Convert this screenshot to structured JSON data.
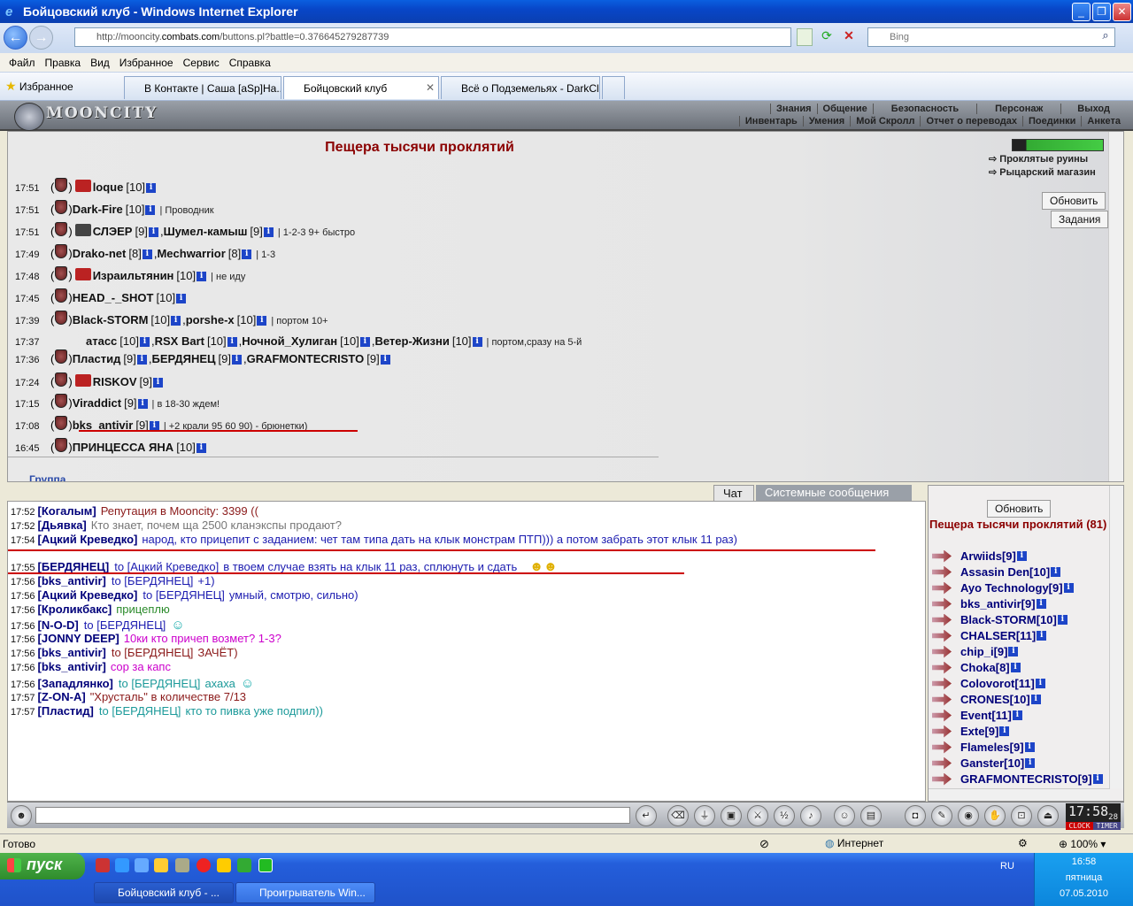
{
  "browser": {
    "title": "Бойцовский клуб - Windows Internet Explorer",
    "url_prefix": "http://mooncity.",
    "url_host": "combats.com",
    "url_rest": "/buttons.pl?battle=0.376645279287739",
    "search_placeholder": "Bing",
    "menu": [
      "Файл",
      "Правка",
      "Вид",
      "Избранное",
      "Сервис",
      "Справка"
    ],
    "favorites": "Избранное",
    "tabs": [
      "В Контакте | Саша [aSp]На...",
      "Бойцовский клуб",
      "Всё о Подземельях - DarkCl..."
    ]
  },
  "game": {
    "logo": "MOONCITY",
    "menu_top": [
      "Знания",
      "Общение",
      "Безопасность",
      "Персонаж",
      "Выход"
    ],
    "menu_bottom": [
      "Инвентарь",
      "Умения",
      "Мой Скролл",
      "Отчет о переводах",
      "Поединки",
      "Анкета"
    ],
    "room_title": "Пещера тысячи проклятий",
    "side_links": [
      "Проклятые руины",
      "Рыцарский магазин"
    ],
    "refresh": "Обновить",
    "tasks": "Задания",
    "group": "Группа",
    "groups": [
      {
        "time": "17:51",
        "players": [
          {
            "nick": "loque",
            "lvl": "[10]"
          }
        ],
        "comment": "",
        "icon": "red"
      },
      {
        "time": "17:51",
        "players": [
          {
            "nick": "Dark-Fire",
            "lvl": "[10]"
          }
        ],
        "comment": "| Проводник"
      },
      {
        "time": "17:51",
        "players": [
          {
            "nick": "СЛЭЕР",
            "lvl": "[9]"
          },
          {
            "nick": "Шумел-камыш",
            "lvl": "[9]"
          }
        ],
        "comment": "| 1-2-3 9+ быстро",
        "icon": "dark"
      },
      {
        "time": "17:49",
        "players": [
          {
            "nick": "Drako-net",
            "lvl": "[8]"
          },
          {
            "nick": "Mechwarrior",
            "lvl": "[8]"
          }
        ],
        "comment": "| 1-3"
      },
      {
        "time": "17:48",
        "players": [
          {
            "nick": "Израильтянин",
            "lvl": "[10]"
          }
        ],
        "comment": "| не иду",
        "icon": "red"
      },
      {
        "time": "17:45",
        "players": [
          {
            "nick": "HEAD_-_SHOT",
            "lvl": "[10]"
          }
        ],
        "comment": ""
      },
      {
        "time": "17:39",
        "players": [
          {
            "nick": "Black-STORM",
            "lvl": "[10]"
          },
          {
            "nick": "porshe-x",
            "lvl": "[10]"
          }
        ],
        "comment": "| портом 10+"
      },
      {
        "time": "17:37",
        "players": [
          {
            "nick": "атасс",
            "lvl": "[10]"
          },
          {
            "nick": "RSX Bart",
            "lvl": "[10]"
          },
          {
            "nick": "Ночной_Хулиган",
            "lvl": "[10]"
          },
          {
            "nick": "Ветер-Жизни",
            "lvl": "[10]"
          }
        ],
        "comment": "| портом,сразу на 5-й",
        "noshield": true
      },
      {
        "time": "17:36",
        "players": [
          {
            "nick": "Пластид",
            "lvl": "[9]"
          },
          {
            "nick": "БЕРДЯНЕЦ",
            "lvl": "[9]"
          },
          {
            "nick": "GRAFMONTECRISTO",
            "lvl": "[9]"
          }
        ],
        "comment": ""
      },
      {
        "time": "17:24",
        "players": [
          {
            "nick": "RISKOV",
            "lvl": "[9]"
          }
        ],
        "comment": "",
        "icon": "red"
      },
      {
        "time": "17:15",
        "players": [
          {
            "nick": "Viraddict",
            "lvl": "[9]"
          }
        ],
        "comment": "| в 18-30 ждем!"
      },
      {
        "time": "17:08",
        "players": [
          {
            "nick": "bks_antivir",
            "lvl": "[9]"
          }
        ],
        "comment": "| +2 крали 95 60 90) - брюнетки)"
      },
      {
        "time": "16:45",
        "players": [
          {
            "nick": "ПРИНЦЕССА ЯНА",
            "lvl": "[10]"
          }
        ],
        "comment": ""
      }
    ],
    "chat_tabs": [
      "Чат",
      "Системные сообщения"
    ],
    "chat": [
      {
        "t": "17:52",
        "who": "[Когалым]",
        "to": "",
        "msg": "Репутация в Mooncity: 3399 ((",
        "color": "#8b1a1a"
      },
      {
        "t": "17:52",
        "who": "[Дьявка]",
        "to": "",
        "msg": "Кто знает, почем ща 2500 кланэкспы продают?",
        "color": "#777777"
      },
      {
        "t": "17:54",
        "who": "[Ацкий Креведко]",
        "to": "",
        "msg": "народ, кто прицепит с заданием: чет там типа дать на клык монстрам ПТП))) а потом забрать этот клык 11 раз)",
        "color": "#1c1cb0"
      },
      {
        "t": "17:55",
        "who": "[БЕРДЯНЕЦ]",
        "to": "to [Ацкий Креведко]",
        "msg": "в твоем случае взять на клык 11 раз, сплюнуть и сдать",
        "color": "#1c1cb0"
      },
      {
        "t": "17:56",
        "who": "[bks_antivir]",
        "to": "to [БЕРДЯНЕЦ]",
        "msg": "+1)",
        "color": "#1c1cb0"
      },
      {
        "t": "17:56",
        "who": "[Ацкий Креведко]",
        "to": "to [БЕРДЯНЕЦ]",
        "msg": "умный, смотрю, сильно)",
        "color": "#1c1cb0"
      },
      {
        "t": "17:56",
        "who": "[Кроликбакс]",
        "to": "",
        "msg": "прицеплю",
        "color": "#2a8a2a"
      },
      {
        "t": "17:56",
        "who": "[N-O-D]",
        "to": "to [БЕРДЯНЕЦ]",
        "msg": "",
        "color": "#1c1cb0"
      },
      {
        "t": "17:56",
        "who": "[JONNY DEEP]",
        "to": "",
        "msg": "10ки кто причеп возмет? 1-3?",
        "color": "#cc00cc"
      },
      {
        "t": "17:56",
        "who": "[bks_antivir]",
        "to": "to [БЕРДЯНЕЦ]",
        "msg": "ЗАЧЁТ)",
        "color": "#8b1a1a"
      },
      {
        "t": "17:56",
        "who": "[bks_antivir]",
        "to": "",
        "msg": "cop за капс",
        "color": "#cc00cc"
      },
      {
        "t": "17:56",
        "who": "[Западлянко]",
        "to": "to [БЕРДЯНЕЦ]",
        "msg": "ахаха",
        "color": "#1c9a9a"
      },
      {
        "t": "17:57",
        "who": "[Z-ON-A]",
        "to": "",
        "msg": "\"Хрусталь\" в количестве 7/13",
        "color": "#8b1a1a"
      },
      {
        "t": "17:57",
        "who": "[Пластид]",
        "to": "to [БЕРДЯНЕЦ]",
        "msg": "кто то пивка уже подпил))",
        "color": "#1c9a9a"
      }
    ],
    "users_refresh": "Обновить",
    "users_title": "Пещера тысячи проклятий",
    "users_count": "(81)",
    "users": [
      {
        "n": "Arwiids",
        "l": "[9]"
      },
      {
        "n": "Assasin Den",
        "l": "[10]"
      },
      {
        "n": "Ayo Technology",
        "l": "[9]"
      },
      {
        "n": "bks_antivir",
        "l": "[9]"
      },
      {
        "n": "Black-STORM",
        "l": "[10]"
      },
      {
        "n": "CHALSER",
        "l": "[11]"
      },
      {
        "n": "chip_i",
        "l": "[9]"
      },
      {
        "n": "Choka",
        "l": "[8]"
      },
      {
        "n": "Colovorot",
        "l": "[11]"
      },
      {
        "n": "CRONES",
        "l": "[10]"
      },
      {
        "n": "Event",
        "l": "[11]"
      },
      {
        "n": "Exte",
        "l": "[9]"
      },
      {
        "n": "Flameles",
        "l": "[9]"
      },
      {
        "n": "Ganster",
        "l": "[10]"
      },
      {
        "n": "GRAFMONTECRISTO",
        "l": "[9]"
      }
    ],
    "clock": "17:58",
    "clock_sec": "28",
    "clock_label": "CLOCK",
    "timer_label": "TIMER"
  },
  "status": {
    "left": "Готово",
    "zone": "Интернет",
    "zoom": "100%"
  },
  "taskbar": {
    "start": "пуск",
    "buttons": [
      "Бойцовский клуб - ...",
      "Проигрыватель Win..."
    ],
    "lang": "RU",
    "time": "16:58",
    "day": "пятница",
    "date": "07.05.2010"
  }
}
